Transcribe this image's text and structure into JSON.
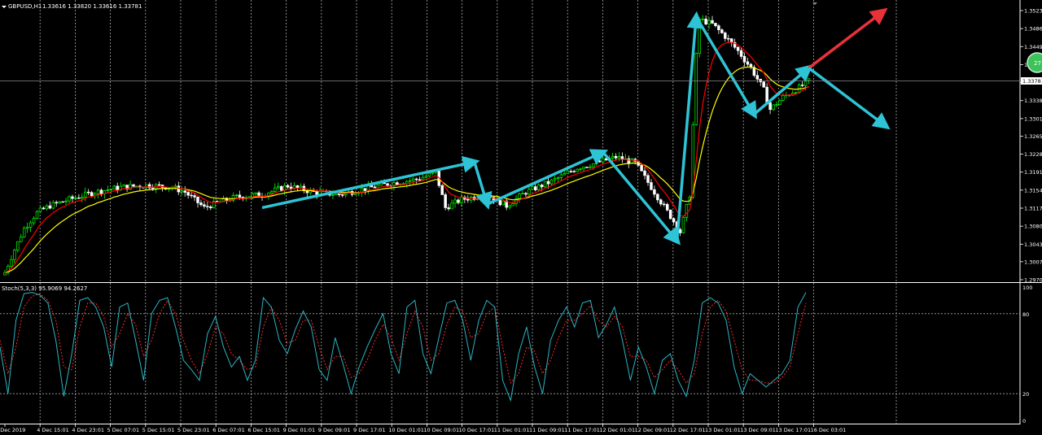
{
  "header": {
    "symbol": "GBPUSD,H1",
    "ohlc": "1.33616 1.33820 1.33616 1.33781"
  },
  "stoch_header": "Stoch(5,3,3) 95.9069 94.2627",
  "current_price": "1.33781",
  "badge_text": "27",
  "colors": {
    "background": "#000000",
    "bull_candle": "#00ff00",
    "bear_candle": "#ffffff",
    "ma_fast": "#ff0000",
    "ma_slow": "#ffff00",
    "arrow": "#2ec4d6",
    "arrow_up": "#e8323a",
    "stoch_main": "#2bb6c4",
    "stoch_signal": "#ff2a2a",
    "grid": "#aaaaaa"
  },
  "chart_data": [
    {
      "type": "candlestick",
      "title": "GBPUSD,H1",
      "price_ticks": [
        "1.35230",
        "1.34860",
        "1.34490",
        "1.34120",
        "1.33750",
        "1.33380",
        "1.33010",
        "1.32650",
        "1.32280",
        "1.31910",
        "1.31540",
        "1.31170",
        "1.30800",
        "1.30430",
        "1.30070",
        "1.29700"
      ],
      "ylim": [
        1.297,
        1.3535
      ],
      "x_ticks": [
        "4 Dec 2019",
        "4 Dec 15:01",
        "4 Dec 23:01",
        "5 Dec 07:01",
        "5 Dec 15:01",
        "5 Dec 23:01",
        "6 Dec 07:01",
        "6 Dec 15:01",
        "9 Dec 01:01",
        "9 Dec 09:01",
        "9 Dec 17:01",
        "10 Dec 01:01",
        "10 Dec 09:01",
        "10 Dec 17:01",
        "11 Dec 01:01",
        "11 Dec 09:01",
        "11 Dec 17:01",
        "12 Dec 01:01",
        "12 Dec 09:01",
        "12 Dec 17:01",
        "13 Dec 01:01",
        "13 Dec 09:01",
        "13 Dec 17:01",
        "16 Dec 03:01"
      ],
      "close_series": [
        {
          "bar": 0,
          "close": 1.2985
        },
        {
          "bar": 3,
          "close": 1.3032
        },
        {
          "bar": 6,
          "close": 1.3075
        },
        {
          "bar": 10,
          "close": 1.3108
        },
        {
          "bar": 14,
          "close": 1.3122
        },
        {
          "bar": 20,
          "close": 1.3135
        },
        {
          "bar": 28,
          "close": 1.315
        },
        {
          "bar": 36,
          "close": 1.316
        },
        {
          "bar": 44,
          "close": 1.3164
        },
        {
          "bar": 52,
          "close": 1.316
        },
        {
          "bar": 56,
          "close": 1.315
        },
        {
          "bar": 62,
          "close": 1.3118
        },
        {
          "bar": 66,
          "close": 1.3128
        },
        {
          "bar": 72,
          "close": 1.314
        },
        {
          "bar": 80,
          "close": 1.3145
        },
        {
          "bar": 88,
          "close": 1.3163
        },
        {
          "bar": 96,
          "close": 1.315
        },
        {
          "bar": 104,
          "close": 1.3145
        },
        {
          "bar": 112,
          "close": 1.3157
        },
        {
          "bar": 120,
          "close": 1.3168
        },
        {
          "bar": 128,
          "close": 1.3176
        },
        {
          "bar": 134,
          "close": 1.319
        },
        {
          "bar": 137,
          "close": 1.3118
        },
        {
          "bar": 142,
          "close": 1.3135
        },
        {
          "bar": 150,
          "close": 1.3145
        },
        {
          "bar": 156,
          "close": 1.3122
        },
        {
          "bar": 162,
          "close": 1.315
        },
        {
          "bar": 170,
          "close": 1.3172
        },
        {
          "bar": 178,
          "close": 1.32
        },
        {
          "bar": 184,
          "close": 1.321
        },
        {
          "bar": 190,
          "close": 1.3222
        },
        {
          "bar": 196,
          "close": 1.321
        },
        {
          "bar": 200,
          "close": 1.317
        },
        {
          "bar": 204,
          "close": 1.313
        },
        {
          "bar": 208,
          "close": 1.309
        },
        {
          "bar": 210,
          "close": 1.3068
        },
        {
          "bar": 213,
          "close": 1.3145
        },
        {
          "bar": 215,
          "close": 1.343
        },
        {
          "bar": 216,
          "close": 1.3505
        },
        {
          "bar": 220,
          "close": 1.3495
        },
        {
          "bar": 224,
          "close": 1.347
        },
        {
          "bar": 228,
          "close": 1.344
        },
        {
          "bar": 232,
          "close": 1.3405
        },
        {
          "bar": 236,
          "close": 1.336
        },
        {
          "bar": 238,
          "close": 1.332
        },
        {
          "bar": 242,
          "close": 1.3345
        },
        {
          "bar": 246,
          "close": 1.336
        },
        {
          "bar": 250,
          "close": 1.3378
        }
      ]
    },
    {
      "type": "line",
      "title": "Stoch(5,3,3) 95.9069 94.2627",
      "y_ticks": [
        "100",
        "80",
        "20",
        "0"
      ],
      "ylim": [
        0,
        100
      ],
      "levels": [
        80,
        20
      ],
      "series": [
        {
          "name": "main",
          "values": [
            55,
            20,
            75,
            95,
            96,
            94,
            88,
            60,
            18,
            50,
            90,
            92,
            85,
            70,
            40,
            85,
            88,
            60,
            30,
            80,
            90,
            92,
            70,
            45,
            38,
            30,
            65,
            78,
            55,
            40,
            48,
            30,
            45,
            92,
            85,
            60,
            50,
            68,
            82,
            70,
            38,
            30,
            62,
            42,
            20,
            40,
            55,
            68,
            80,
            50,
            35,
            85,
            90,
            50,
            35,
            62,
            88,
            90,
            75,
            45,
            75,
            90,
            85,
            30,
            15,
            50,
            70,
            40,
            20,
            60,
            75,
            85,
            70,
            88,
            90,
            62,
            72,
            85,
            60,
            30,
            55,
            40,
            20,
            45,
            50,
            30,
            18,
            45,
            88,
            92,
            88,
            75,
            40,
            20,
            35,
            30,
            25,
            30,
            35,
            45,
            85,
            96
          ]
        },
        {
          "name": "signal",
          "values": [
            60,
            35,
            55,
            85,
            93,
            95,
            90,
            75,
            40,
            38,
            70,
            88,
            88,
            78,
            55,
            65,
            80,
            72,
            48,
            60,
            80,
            90,
            80,
            60,
            45,
            35,
            50,
            70,
            65,
            50,
            45,
            38,
            40,
            70,
            85,
            75,
            58,
            60,
            75,
            75,
            55,
            38,
            48,
            48,
            32,
            35,
            45,
            60,
            72,
            62,
            45,
            65,
            82,
            70,
            45,
            50,
            72,
            85,
            82,
            62,
            65,
            80,
            85,
            55,
            28,
            35,
            55,
            52,
            35,
            45,
            62,
            75,
            75,
            80,
            86,
            75,
            70,
            78,
            70,
            48,
            48,
            45,
            32,
            38,
            45,
            38,
            28,
            35,
            65,
            85,
            90,
            82,
            60,
            38,
            30,
            30,
            28,
            28,
            32,
            40,
            65,
            88
          ]
        }
      ]
    }
  ]
}
